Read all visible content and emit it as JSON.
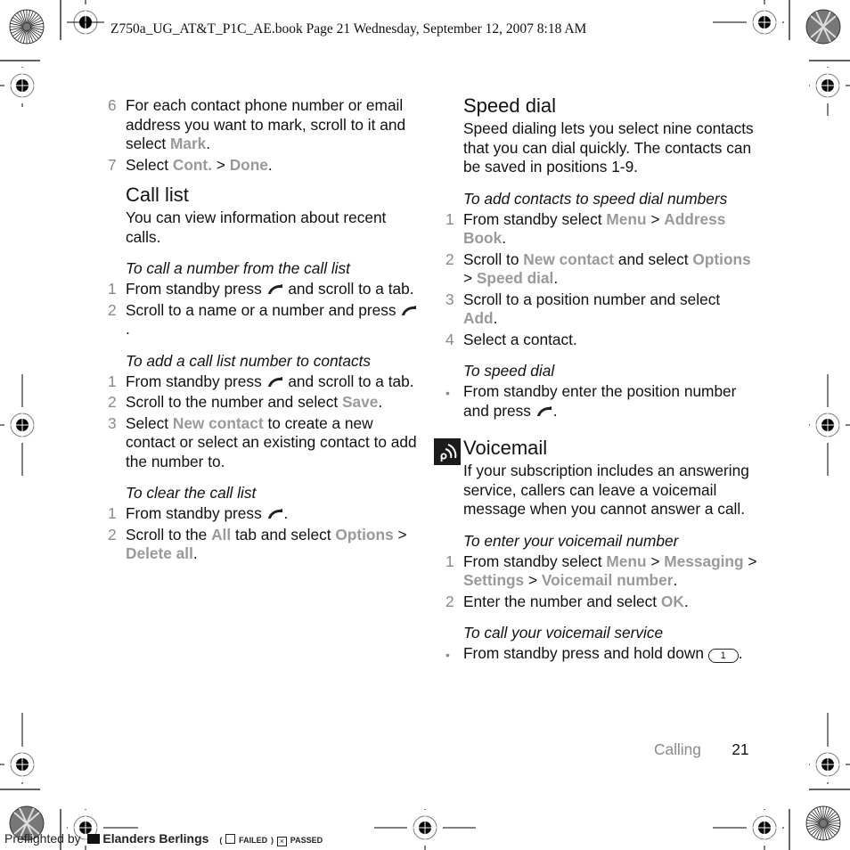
{
  "header": {
    "text": "Z750a_UG_AT&T_P1C_AE.book  Page 21  Wednesday, September 12, 2007  8:18 AM"
  },
  "left_column": {
    "continued_steps": [
      {
        "num": "6",
        "parts": [
          {
            "t": "For each contact phone number or email address you want to mark, scroll to it and select "
          },
          {
            "m": "Mark"
          },
          {
            "t": "."
          }
        ]
      },
      {
        "num": "7",
        "parts": [
          {
            "t": "Select "
          },
          {
            "m": "Cont."
          },
          {
            "t": " > "
          },
          {
            "m": "Done"
          },
          {
            "t": "."
          }
        ]
      }
    ],
    "call_list": {
      "title": "Call list",
      "intro": "You can view information about recent calls.",
      "procedures": [
        {
          "title": "To call a number from the call list",
          "steps": [
            {
              "num": "1",
              "parts": [
                {
                  "t": "From standby press "
                },
                {
                  "icon": "call-key"
                },
                {
                  "t": " and scroll to a tab."
                }
              ]
            },
            {
              "num": "2",
              "parts": [
                {
                  "t": "Scroll to a name or a number and press "
                },
                {
                  "icon": "call-key"
                },
                {
                  "t": "."
                }
              ]
            }
          ]
        },
        {
          "title": "To add a call list number to contacts",
          "steps": [
            {
              "num": "1",
              "parts": [
                {
                  "t": "From standby press "
                },
                {
                  "icon": "call-key"
                },
                {
                  "t": " and scroll to a tab."
                }
              ]
            },
            {
              "num": "2",
              "parts": [
                {
                  "t": "Scroll to the number and select "
                },
                {
                  "m": "Save"
                },
                {
                  "t": "."
                }
              ]
            },
            {
              "num": "3",
              "parts": [
                {
                  "t": "Select "
                },
                {
                  "m": "New contact"
                },
                {
                  "t": " to create a new contact or select an existing contact to add the number to."
                }
              ]
            }
          ]
        },
        {
          "title": "To clear the call list",
          "steps": [
            {
              "num": "1",
              "parts": [
                {
                  "t": "From standby press "
                },
                {
                  "icon": "call-key"
                },
                {
                  "t": "."
                }
              ]
            },
            {
              "num": "2",
              "parts": [
                {
                  "t": "Scroll to the "
                },
                {
                  "m": "All"
                },
                {
                  "t": " tab and select "
                },
                {
                  "m": "Options"
                },
                {
                  "t": " > "
                },
                {
                  "m": "Delete all"
                },
                {
                  "t": "."
                }
              ]
            }
          ]
        }
      ]
    }
  },
  "right_column": {
    "speed_dial": {
      "title": "Speed dial",
      "intro": "Speed dialing lets you select nine contacts that you can dial quickly. The contacts can be saved in positions 1-9.",
      "procedures": [
        {
          "title": "To add contacts to speed dial numbers",
          "steps": [
            {
              "num": "1",
              "parts": [
                {
                  "t": "From standby select "
                },
                {
                  "m": "Menu"
                },
                {
                  "t": " > "
                },
                {
                  "m": "Address Book"
                },
                {
                  "t": "."
                }
              ]
            },
            {
              "num": "2",
              "parts": [
                {
                  "t": "Scroll to "
                },
                {
                  "m": "New contact"
                },
                {
                  "t": " and select "
                },
                {
                  "m": "Options"
                },
                {
                  "t": " > "
                },
                {
                  "m": "Speed dial"
                },
                {
                  "t": "."
                }
              ]
            },
            {
              "num": "3",
              "parts": [
                {
                  "t": "Scroll to a position number and select "
                },
                {
                  "m": "Add"
                },
                {
                  "t": "."
                }
              ]
            },
            {
              "num": "4",
              "parts": [
                {
                  "t": "Select a contact."
                }
              ]
            }
          ]
        },
        {
          "title": "To speed dial",
          "steps": [
            {
              "bullet": "•",
              "parts": [
                {
                  "t": "From standby enter the position number and press "
                },
                {
                  "icon": "call-key"
                },
                {
                  "t": "."
                }
              ]
            }
          ]
        }
      ]
    },
    "voicemail": {
      "title": "Voicemail",
      "icon": "operator-service-icon",
      "intro": "If your subscription includes an answering service, callers can leave a voicemail message when you cannot answer a call.",
      "procedures": [
        {
          "title": "To enter your voicemail number",
          "steps": [
            {
              "num": "1",
              "parts": [
                {
                  "t": "From standby select "
                },
                {
                  "m": "Menu"
                },
                {
                  "t": " > "
                },
                {
                  "m": "Messaging"
                },
                {
                  "t": " > "
                },
                {
                  "m": "Settings"
                },
                {
                  "t": " > "
                },
                {
                  "m": "Voicemail number"
                },
                {
                  "t": "."
                }
              ]
            },
            {
              "num": "2",
              "parts": [
                {
                  "t": "Enter the number and select "
                },
                {
                  "m": "OK"
                },
                {
                  "t": "."
                }
              ]
            }
          ]
        },
        {
          "title": "To call your voicemail service",
          "steps": [
            {
              "bullet": "•",
              "parts": [
                {
                  "t": "From standby press and hold down "
                },
                {
                  "key": "1"
                },
                {
                  "t": "."
                }
              ]
            }
          ]
        }
      ]
    }
  },
  "footer": {
    "section": "Calling",
    "page_number": "21"
  },
  "preflight": {
    "prefix": "Preflighted by",
    "brand": "Elanders Berlings",
    "failed_label": "FAILED",
    "passed_label": "PASSED",
    "passed_checked": true,
    "failed_checked": false
  },
  "colors": {
    "menu_text": "#8c8c8c",
    "step_number": "#8a8a8a",
    "body_text": "#111111"
  }
}
